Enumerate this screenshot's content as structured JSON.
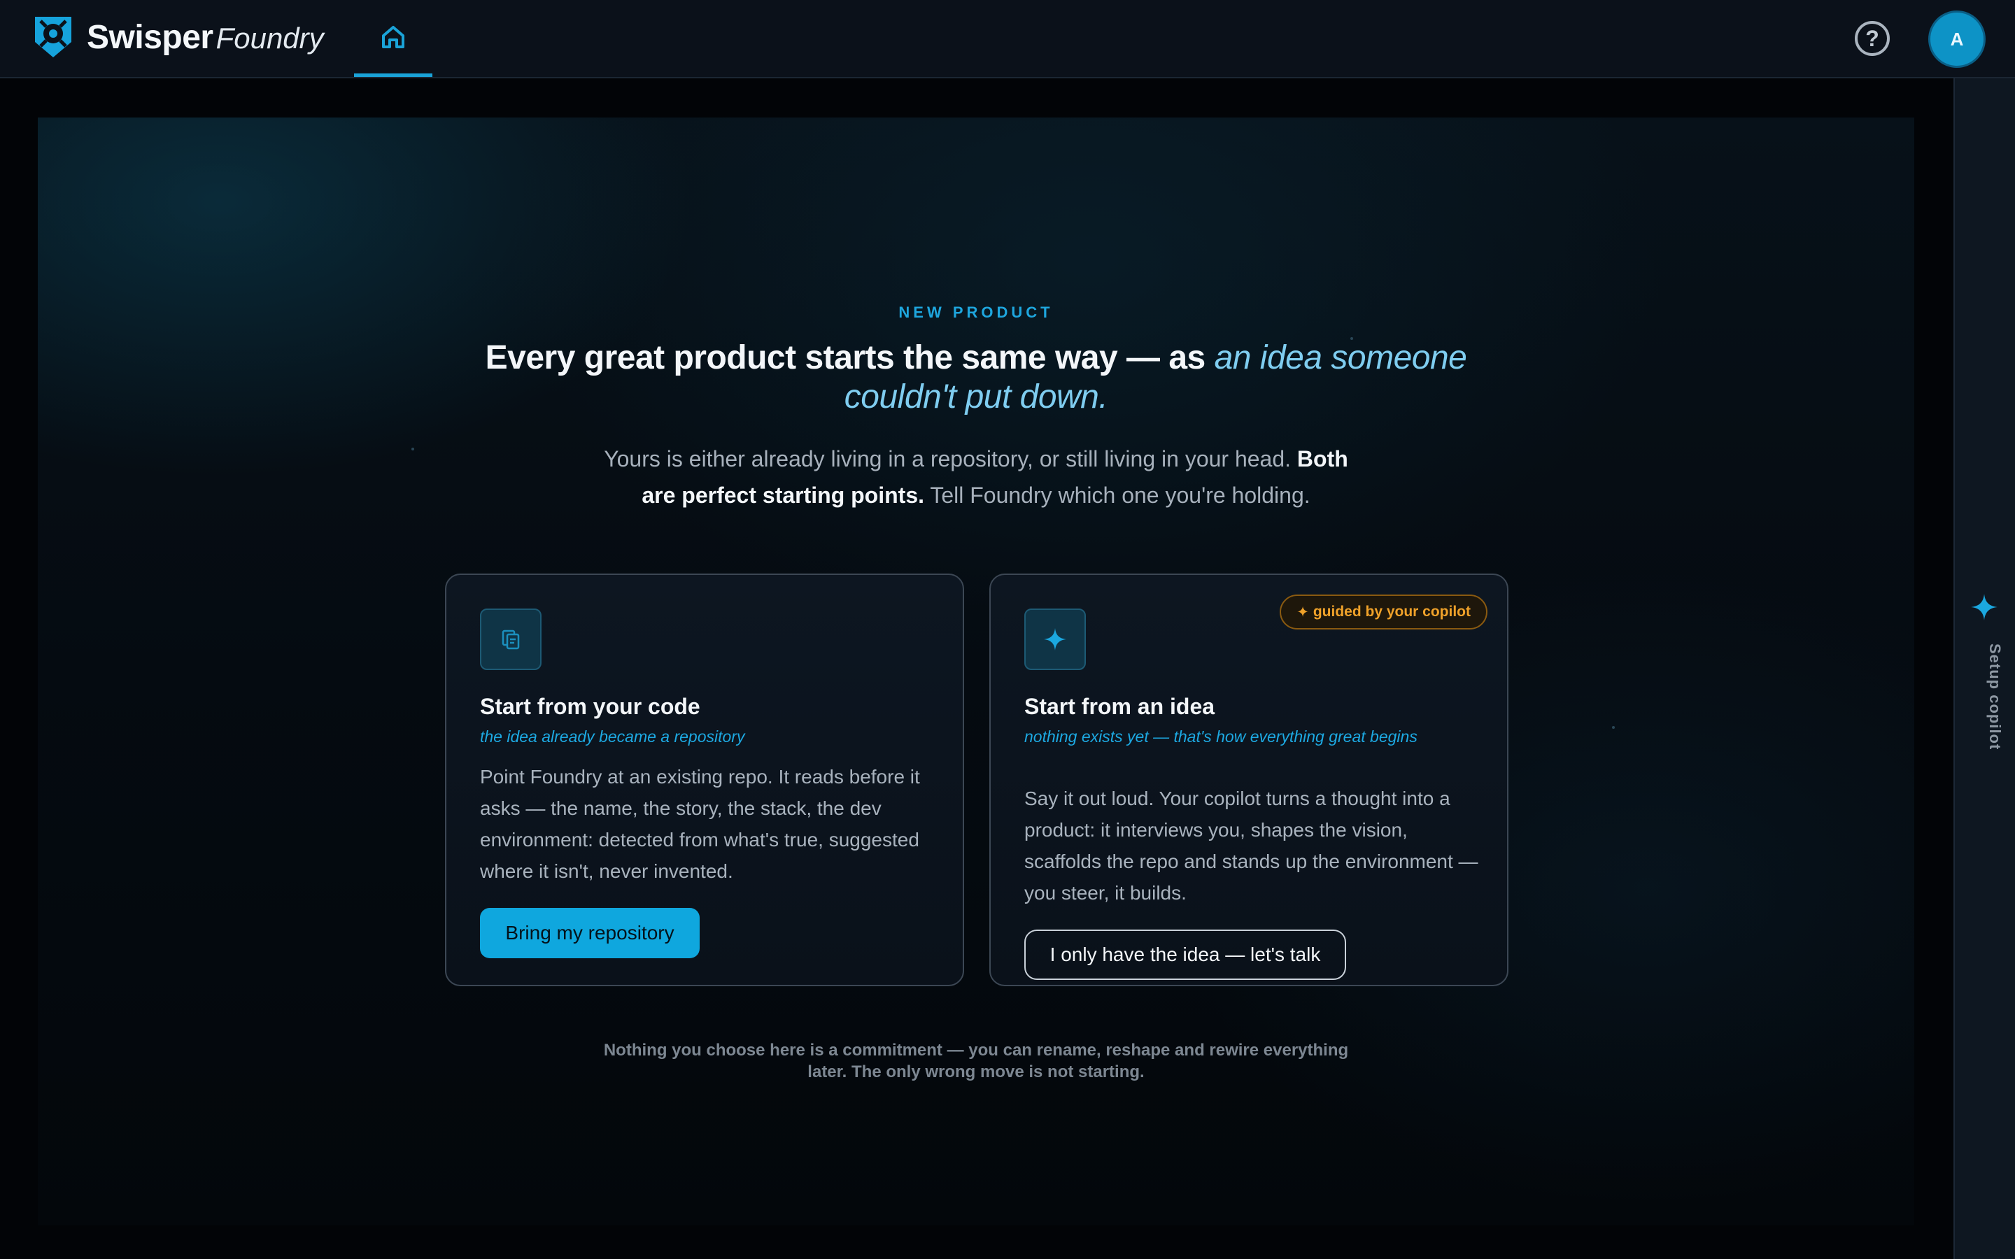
{
  "app": {
    "brand_primary": "Swisper",
    "brand_secondary": "Foundry",
    "logo_icon": "shield-logo-icon",
    "home_icon": "home-icon",
    "help_icon": "question-circle-icon",
    "avatar_initial": "A"
  },
  "colors": {
    "accent": "#0fa7de",
    "accent_text": "#1ea6de",
    "headline_accent": "#7fcdf0",
    "badge": "#f0a22a",
    "background": "#020407"
  },
  "hero": {
    "eyebrow": "NEW PRODUCT",
    "headline_lead": "Every great product starts the same way — as ",
    "headline_accent": "an idea someone couldn't put down.",
    "subhead_a": "Yours is either already living in a repository, or still living in your head. ",
    "subhead_bold": "Both are perfect starting points.",
    "subhead_b": " Tell Foundry which one you're holding."
  },
  "cards": [
    {
      "icon": "repository-icon",
      "title": "Start from your code",
      "tagline": "the idea already became a repository",
      "body": "Point Foundry at an existing repo. It reads before it asks — the name, the story, the stack, the dev environment: detected from what's true, suggested where it isn't, never invented.",
      "button_label": "Bring my repository"
    },
    {
      "icon": "sparkle-icon",
      "badge_star": "✦",
      "badge": "guided by your copilot",
      "title": "Start from an idea",
      "tagline": "nothing exists yet — that's how everything great begins",
      "body": "Say it out loud. Your copilot turns a thought into a product: it interviews you, shapes the vision, scaffolds the repo and stands up the environment — you steer, it builds.",
      "button_label": "I only have the idea — let's talk"
    }
  ],
  "footnote": "Nothing you choose here is a commitment — you can rename, reshape and rewire everything later. The only wrong move is not starting.",
  "rail": {
    "icon": "sparkle-icon",
    "label": "Setup copilot"
  }
}
